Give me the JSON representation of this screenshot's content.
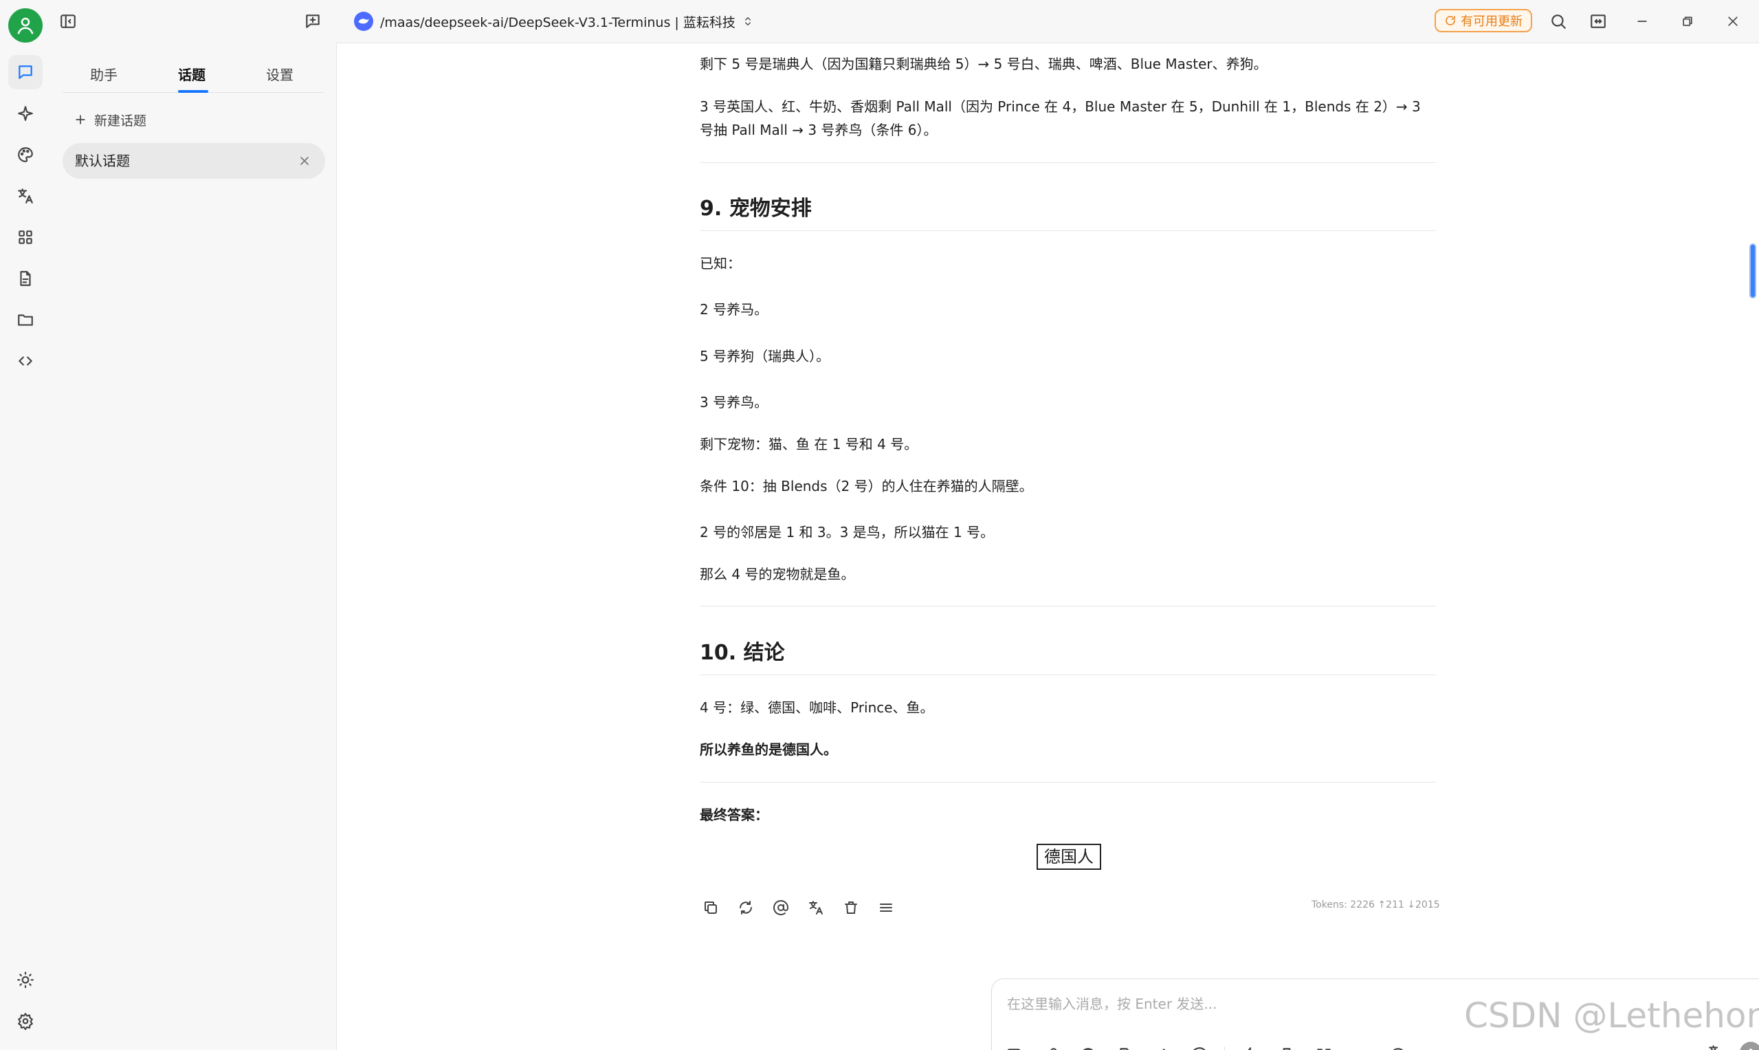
{
  "titlebar": {
    "model_title": "/maas/deepseek-ai/DeepSeek-V3.1-Terminus | 蓝耘科技",
    "update_label": "有可用更新"
  },
  "sidebar": {
    "tabs": [
      {
        "label": "助手",
        "active": false
      },
      {
        "label": "话题",
        "active": true
      },
      {
        "label": "设置",
        "active": false
      }
    ],
    "new_topic_label": "新建话题",
    "topics": [
      {
        "label": "默认话题"
      }
    ]
  },
  "content": {
    "para_1": "剩下 5 号是瑞典人（因为国籍只剩瑞典给 5）→ 5 号白、瑞典、啤酒、Blue Master、养狗。",
    "para_2": "3 号英国人、红、牛奶、香烟剩 Pall Mall（因为 Prince 在 4，Blue Master 在 5，Dunhill 在 1，Blends 在 2）→ 3 号抽 Pall Mall → 3 号养鸟（条件 6）。",
    "heading_9": "9. 宠物安排",
    "known": "已知：",
    "fact_1": "2 号养马。",
    "fact_2": "5 号养狗（瑞典人）。",
    "fact_3": "3 号养鸟。",
    "remaining": "剩下宠物：猫、鱼 在 1 号和 4 号。",
    "condition_10": "条件 10：抽 Blends（2 号）的人住在养猫的人隔壁。",
    "neighbors": "2 号的邻居是 1 和 3。3 是鸟，所以猫在 1 号。",
    "fish": "那么 4 号的宠物就是鱼。",
    "heading_10": "10. 结论",
    "house_4": "4 号：绿、德国、咖啡、Prince、鱼。",
    "conclusion": "所以养鱼的是德国人。",
    "final_label": "最终答案：",
    "answer": "德国人"
  },
  "message": {
    "tokens": "Tokens: 2226 ↑211 ↓2015"
  },
  "input": {
    "placeholder": "在这里输入消息，按 Enter 发送..."
  },
  "watermark": "CSDN @Lethehong",
  "colors": {
    "avatar": "#21a34a",
    "accent": "#1677ff",
    "update": "#e87d12",
    "model_logo": "#4d6bfe"
  }
}
